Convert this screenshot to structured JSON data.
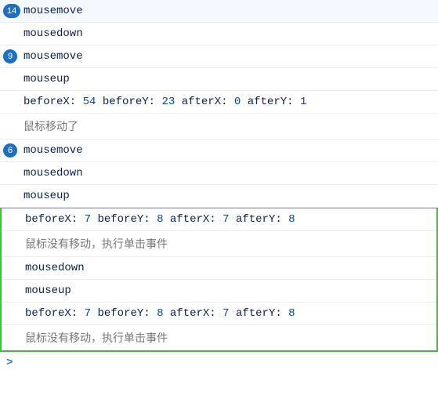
{
  "entries": [
    {
      "type": "msg",
      "badge": "14",
      "text": "mousemove",
      "cn": false
    },
    {
      "type": "msg",
      "badge": null,
      "text": "mousedown",
      "cn": false
    },
    {
      "type": "msg",
      "badge": "9",
      "text": "mousemove",
      "cn": false
    },
    {
      "type": "msg",
      "badge": null,
      "text": "mouseup",
      "cn": false
    },
    {
      "type": "kv",
      "badge": null,
      "values": {
        "beforeX": "54",
        "beforeY": "23",
        "afterX": "0",
        "afterY": "1"
      }
    },
    {
      "type": "msg",
      "badge": null,
      "text": "鼠标移动了",
      "cn": true
    },
    {
      "type": "msg",
      "badge": "6",
      "text": "mousemove",
      "cn": false
    },
    {
      "type": "msg",
      "badge": null,
      "text": "mousedown",
      "cn": false
    },
    {
      "type": "msg",
      "badge": null,
      "text": "mouseup",
      "cn": false
    }
  ],
  "highlight": [
    {
      "type": "kv",
      "badge": null,
      "values": {
        "beforeX": "7",
        "beforeY": "8",
        "afterX": "7",
        "afterY": "8"
      }
    },
    {
      "type": "msg",
      "badge": null,
      "text": "鼠标没有移动，执行单击事件",
      "cn": true
    },
    {
      "type": "msg",
      "badge": null,
      "text": "mousedown",
      "cn": false
    },
    {
      "type": "msg",
      "badge": null,
      "text": "mouseup",
      "cn": false
    },
    {
      "type": "kv",
      "badge": null,
      "values": {
        "beforeX": "7",
        "beforeY": "8",
        "afterX": "7",
        "afterY": "8"
      }
    },
    {
      "type": "msg",
      "badge": null,
      "text": "鼠标没有移动，执行单击事件",
      "cn": true
    }
  ],
  "kvLabels": {
    "beforeX": "beforeX",
    "beforeY": "beforeY",
    "afterX": "afterX",
    "afterY": "afterY"
  },
  "prompt": ">"
}
